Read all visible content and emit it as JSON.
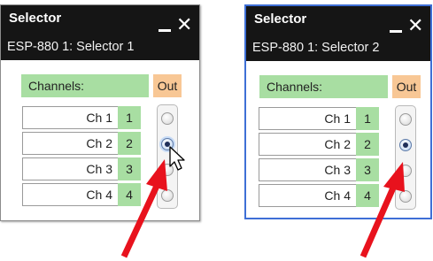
{
  "windows": [
    {
      "title": "Selector",
      "subtitle": "ESP-880 1: Selector 1",
      "channels_label": "Channels:",
      "out_label": "Out",
      "rows": [
        {
          "name": "Ch 1",
          "number": "1"
        },
        {
          "name": "Ch 2",
          "number": "2"
        },
        {
          "name": "Ch 3",
          "number": "3"
        },
        {
          "name": "Ch 4",
          "number": "4"
        }
      ],
      "selected_index": 1
    },
    {
      "title": "Selector",
      "subtitle": "ESP-880 1: Selector 2",
      "channels_label": "Channels:",
      "out_label": "Out",
      "rows": [
        {
          "name": "Ch 1",
          "number": "1"
        },
        {
          "name": "Ch 2",
          "number": "2"
        },
        {
          "name": "Ch 3",
          "number": "3"
        },
        {
          "name": "Ch 4",
          "number": "4"
        }
      ],
      "selected_index": 1
    }
  ],
  "colors": {
    "title_bar": "#151515",
    "channel_green": "#a8dea2",
    "out_orange": "#f8c795",
    "active_border": "#3e6fd6",
    "arrow_red": "#e8121d"
  }
}
